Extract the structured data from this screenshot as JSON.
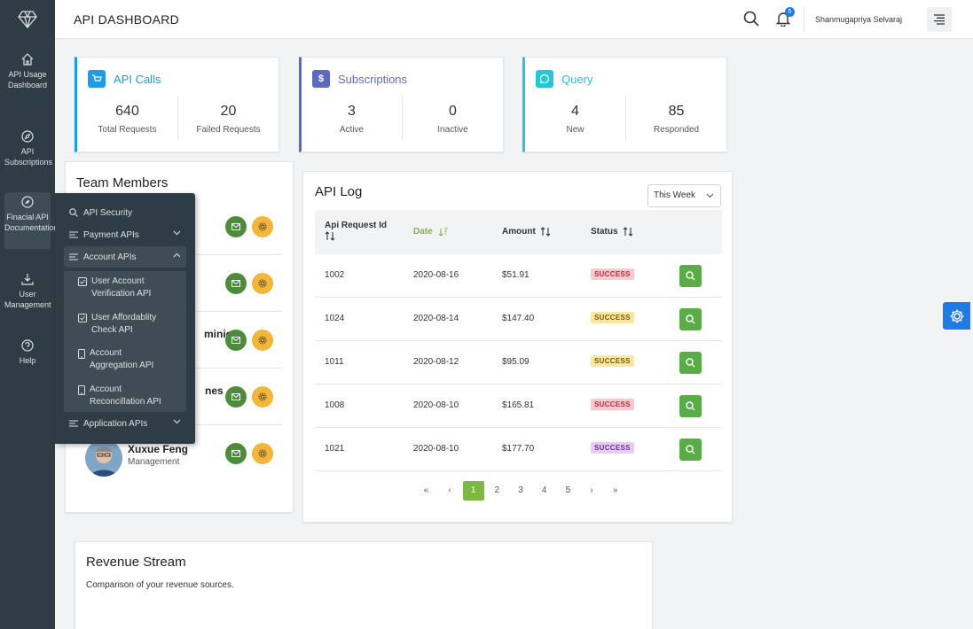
{
  "header": {
    "title": "API DASHBOARD",
    "notifications": "5",
    "user": "Shanmugapriya Selvaraj"
  },
  "sidebar": {
    "items": [
      {
        "label": "API Usage Dashboard",
        "icon": "home-icon"
      },
      {
        "label": "API Subscriptions",
        "icon": "compass-icon"
      },
      {
        "label": "Finacial API Documentation",
        "icon": "compass-icon"
      },
      {
        "label": "User Management",
        "icon": "download-icon"
      },
      {
        "label": "Help",
        "icon": "help-icon"
      }
    ]
  },
  "stats": [
    {
      "title": "API Calls",
      "color": "#1e9be6",
      "icon": "cart-icon",
      "cols": [
        {
          "value": "640",
          "label": "Total Requests"
        },
        {
          "value": "20",
          "label": "Failed Requests"
        }
      ]
    },
    {
      "title": "Subscriptions",
      "color": "#5c6bc0",
      "icon": "dollar-icon",
      "cols": [
        {
          "value": "3",
          "label": "Active"
        },
        {
          "value": "0",
          "label": "Inactive"
        }
      ]
    },
    {
      "title": "Query",
      "color": "#26c6da",
      "icon": "chat-icon",
      "cols": [
        {
          "value": "4",
          "label": "New"
        },
        {
          "value": "85",
          "label": "Responded"
        }
      ]
    }
  ],
  "team": {
    "title": "Team Members",
    "members": [
      {
        "name": "",
        "role": ""
      },
      {
        "name": "",
        "role": ""
      },
      {
        "name": "minic",
        "role": ""
      },
      {
        "name": "nes",
        "role": ""
      },
      {
        "name": "Xuxue Feng",
        "role": "Management"
      }
    ]
  },
  "dropdown": {
    "items": [
      {
        "label": "API Security"
      },
      {
        "label": "Payment APIs"
      },
      {
        "label": "Account APIs"
      },
      {
        "label": "Application APIs"
      }
    ],
    "sub_items": [
      {
        "line1": "User Account",
        "line2": "Verification API"
      },
      {
        "line1": "User Affordablity",
        "line2": "Check API"
      },
      {
        "line1": "Account",
        "line2": "Aggregation API"
      },
      {
        "line1": "Account",
        "line2": "Reconcillation API"
      }
    ]
  },
  "api_log": {
    "title": "API Log",
    "period": "This Week",
    "columns": {
      "id": "Api Request Id",
      "date": "Date",
      "amount": "Amount",
      "status": "Status"
    },
    "rows": [
      {
        "id": "1002",
        "date": "2020-08-16",
        "amount": "$51.91",
        "status": "SUCCESS",
        "badge_bg": "#f9c9cf",
        "badge_fg": "#b0303f"
      },
      {
        "id": "1024",
        "date": "2020-08-14",
        "amount": "$147.40",
        "status": "SUCCESS",
        "badge_bg": "#fbe6a6",
        "badge_fg": "#7a5a00"
      },
      {
        "id": "1011",
        "date": "2020-08-12",
        "amount": "$95.09",
        "status": "SUCCESS",
        "badge_bg": "#fbe6a6",
        "badge_fg": "#7a5a00"
      },
      {
        "id": "1008",
        "date": "2020-08-10",
        "amount": "$165.81",
        "status": "SUCCESS",
        "badge_bg": "#f9c9cf",
        "badge_fg": "#b0303f"
      },
      {
        "id": "1021",
        "date": "2020-08-10",
        "amount": "$177.70",
        "status": "SUCCESS",
        "badge_bg": "#e6cdf5",
        "badge_fg": "#6a2d8f"
      }
    ],
    "pages": [
      "1",
      "2",
      "3",
      "4",
      "5"
    ],
    "first": "«",
    "prev": "‹",
    "next": "›",
    "last": "»"
  },
  "revenue": {
    "title": "Revenue Stream",
    "subtitle": "Comparison of your revenue sources."
  }
}
